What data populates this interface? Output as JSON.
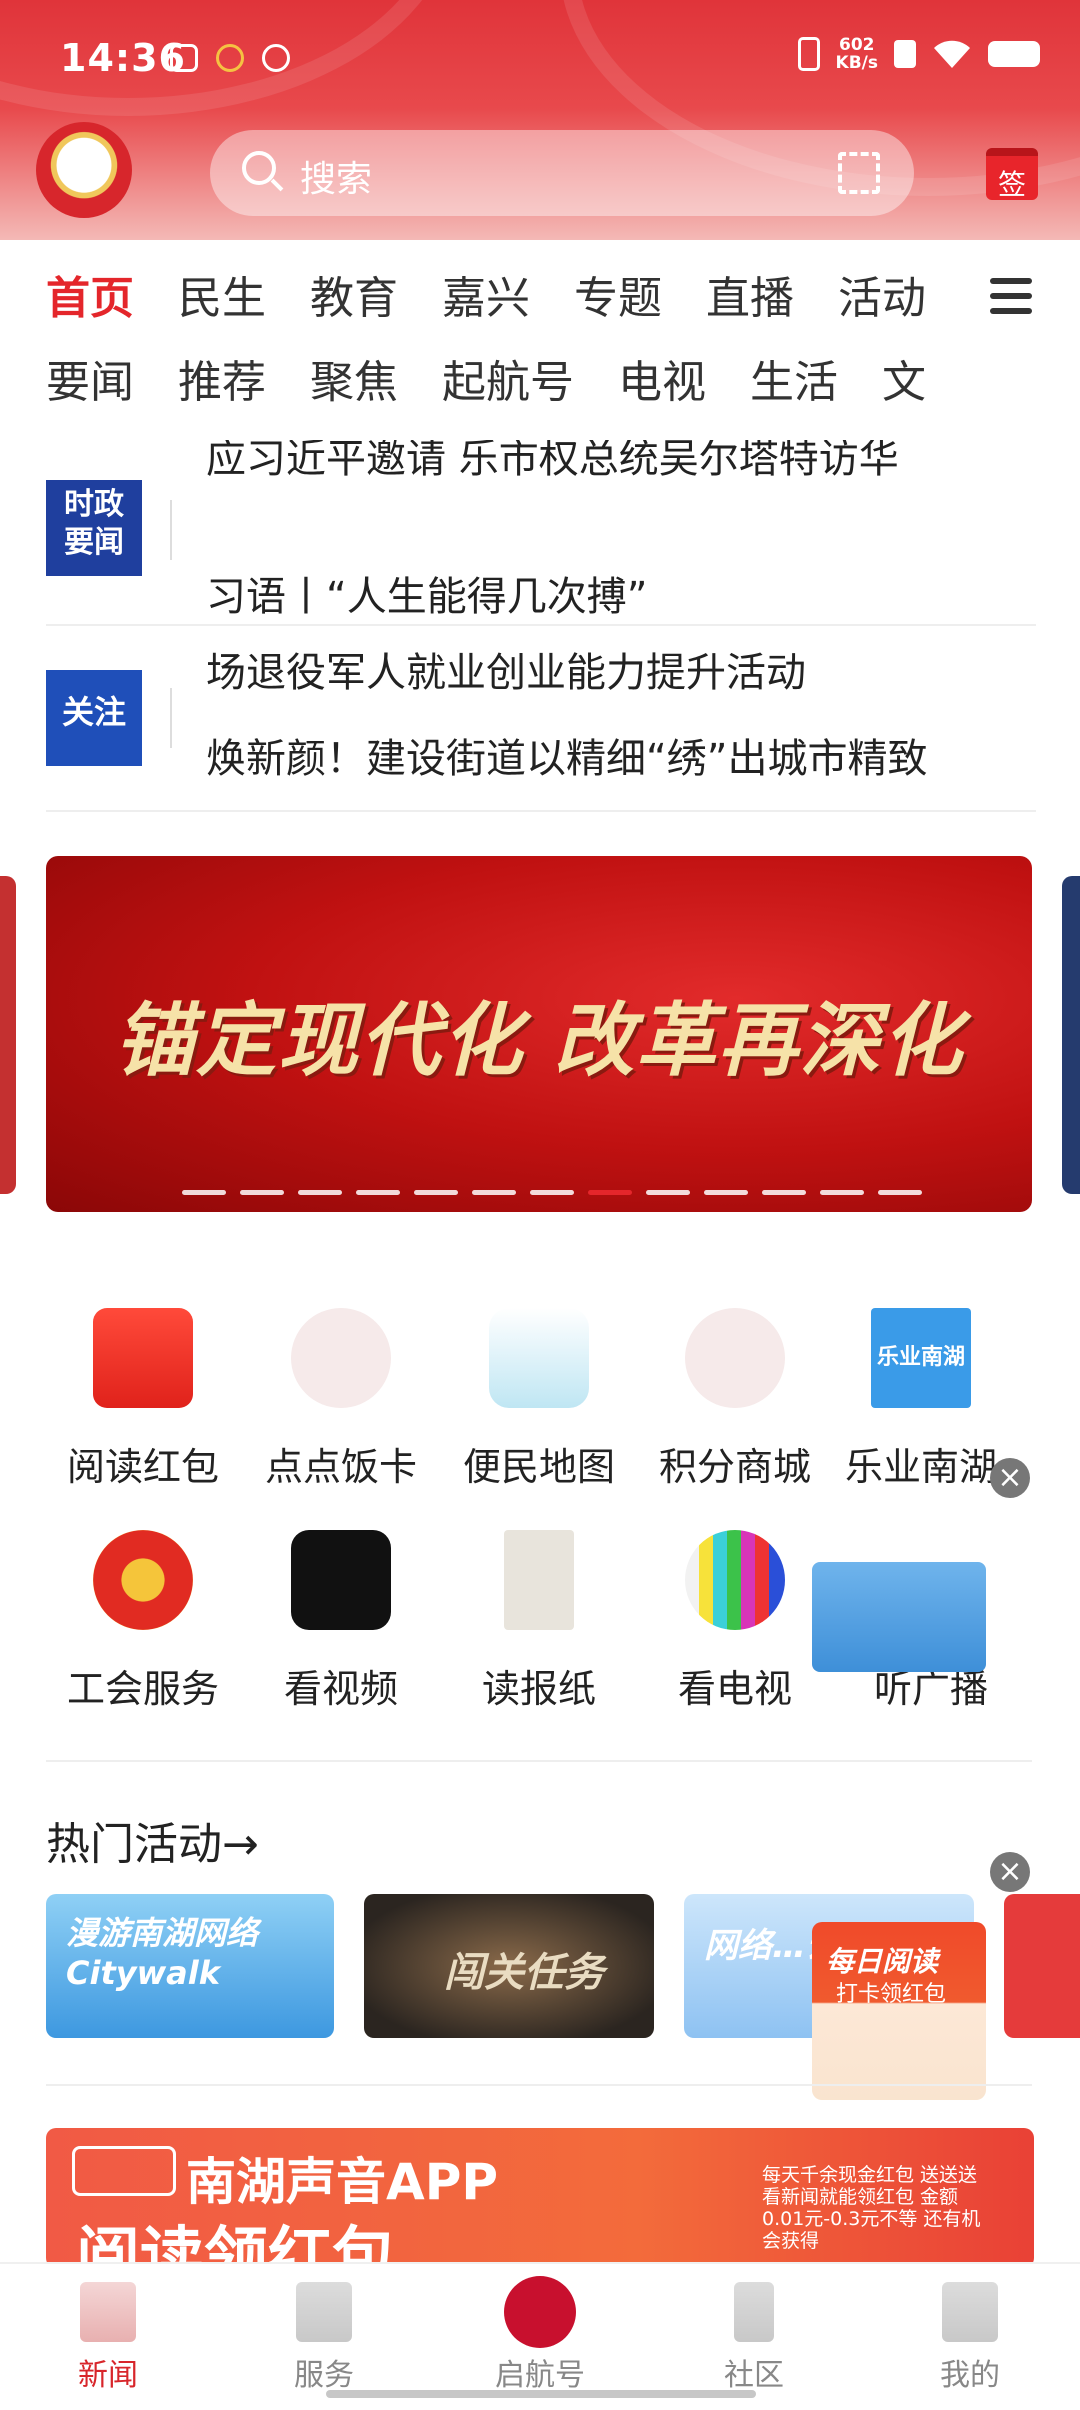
{
  "status_bar": {
    "time": "14:36",
    "speed_value": "602",
    "speed_unit": "KB/s"
  },
  "header": {
    "search_placeholder": "搜索",
    "sign_label": "签"
  },
  "tabs_row1": [
    "首页",
    "民生",
    "教育",
    "嘉兴",
    "专题",
    "直播",
    "活动"
  ],
  "tabs_row2": [
    "要闻",
    "推荐",
    "聚焦",
    "起航号",
    "电视",
    "生活",
    "文"
  ],
  "news": [
    {
      "badge": "时政\n要闻",
      "line1": "应习近平邀请 乐市权总统吴尔塔特访华",
      "line2": "习语丨“人生能得几次搏”"
    },
    {
      "badge": "关注",
      "line1": "场退役军人就业创业能力提升活动",
      "line2": "焕新颜！建设街道以精细“绣”出城市精致"
    }
  ],
  "banner": {
    "title": "锚定现代化 改革再深化",
    "dot_count": 13,
    "active_dot": 8
  },
  "services_row1": [
    "阅读红包",
    "点点饭卡",
    "便民地图",
    "积分商城",
    "乐业南湖"
  ],
  "services_row2": [
    "工会服务",
    "看视频",
    "读报纸",
    "看电视",
    "听广播"
  ],
  "service_icon_text": {
    "leye": "乐业南湖"
  },
  "hot": {
    "title": "热门活动→",
    "cards": [
      "漫游南湖网络 Citywalk",
      "闯关任务",
      "网络…云…"
    ]
  },
  "float_ad": {
    "line1": "每日阅读",
    "line2": "打卡领红包"
  },
  "bottom_ad": {
    "brand": "南湖声音APP",
    "slogan": "阅读领红包",
    "info": "每天千余现金红包 送送送 看新闻就能领红包 金额0.01元-0.3元不等 还有机会获得"
  },
  "nav": [
    {
      "label": "新闻",
      "active": true
    },
    {
      "label": "服务",
      "active": false
    },
    {
      "label": "启航号",
      "active": false
    },
    {
      "label": "社区",
      "active": false
    },
    {
      "label": "我的",
      "active": false
    }
  ],
  "colors": {
    "brand_red": "#e4262b",
    "nav_active": "#d8262b"
  }
}
